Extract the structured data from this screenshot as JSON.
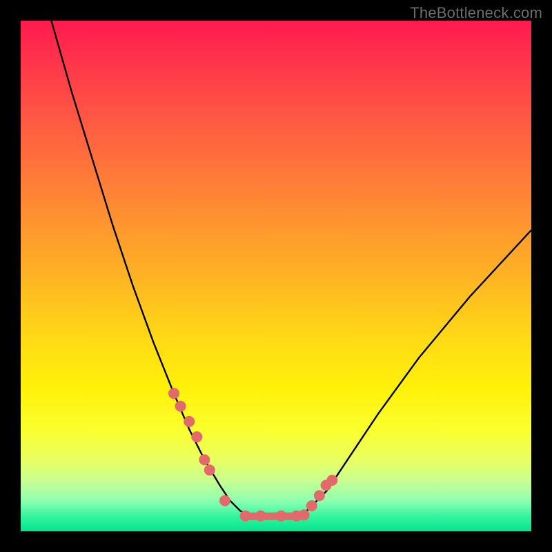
{
  "watermark": "TheBottleneck.com",
  "chart_data": {
    "type": "line",
    "title": "",
    "xlabel": "",
    "ylabel": "",
    "xlim": [
      0,
      1
    ],
    "ylim": [
      0,
      1
    ],
    "series": [
      {
        "name": "bottleneck-curve",
        "x": [
          0.06,
          0.1,
          0.14,
          0.18,
          0.22,
          0.26,
          0.3,
          0.33,
          0.36,
          0.39,
          0.41,
          0.43,
          0.45,
          0.48,
          0.52,
          0.55,
          0.57,
          0.6,
          0.64,
          0.7,
          0.78,
          0.88,
          1.0
        ],
        "y": [
          1.0,
          0.86,
          0.73,
          0.6,
          0.48,
          0.37,
          0.27,
          0.2,
          0.14,
          0.09,
          0.06,
          0.04,
          0.03,
          0.03,
          0.03,
          0.03,
          0.05,
          0.08,
          0.14,
          0.23,
          0.34,
          0.46,
          0.59
        ]
      }
    ],
    "markers": {
      "name": "highlighted-points",
      "color": "#e26a6a",
      "x": [
        0.3,
        0.313,
        0.33,
        0.345,
        0.36,
        0.37,
        0.4,
        0.44,
        0.47,
        0.51,
        0.54,
        0.555,
        0.57,
        0.585,
        0.598,
        0.61
      ],
      "y": [
        0.27,
        0.245,
        0.215,
        0.185,
        0.14,
        0.12,
        0.06,
        0.03,
        0.03,
        0.03,
        0.03,
        0.032,
        0.05,
        0.07,
        0.09,
        0.1
      ]
    },
    "flat_segment": {
      "name": "bottom-bar",
      "color": "#e26a6a",
      "x0": 0.43,
      "x1": 0.55,
      "y": 0.03
    }
  }
}
